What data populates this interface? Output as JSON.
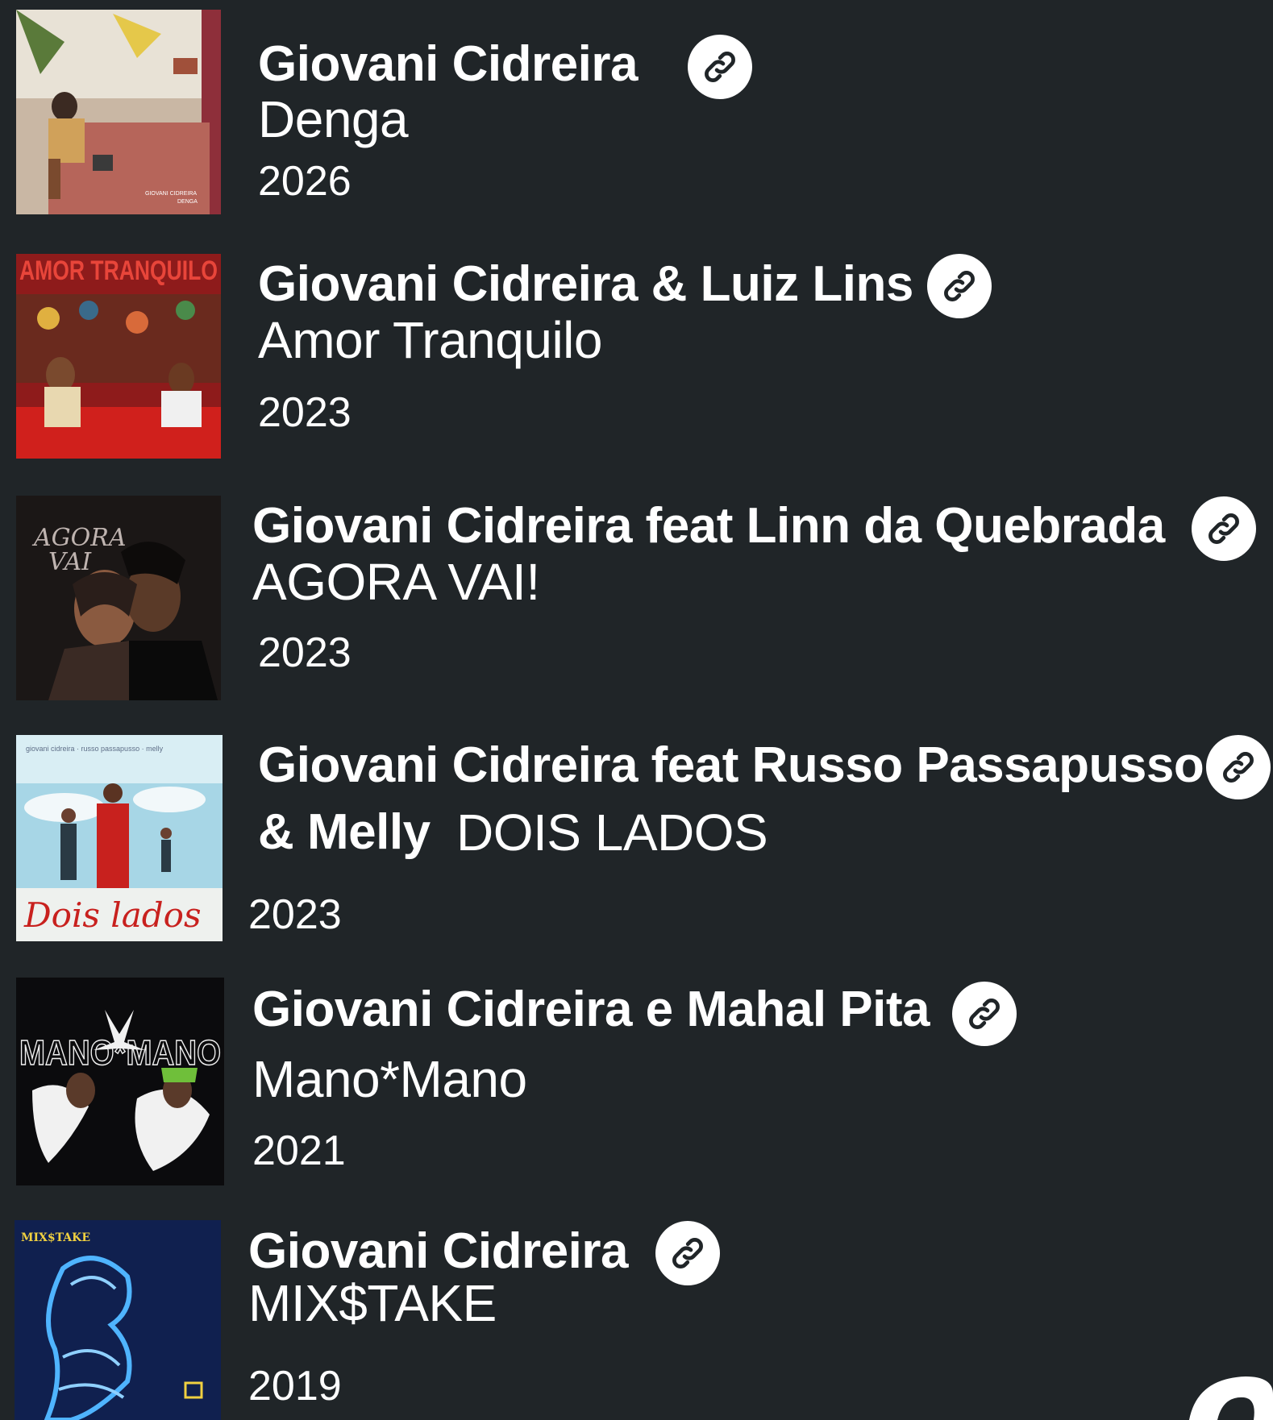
{
  "releases": [
    {
      "artist": "Giovani Cidreira",
      "title": "Denga",
      "year": "2026",
      "cover_text": [
        "GIOVANI CIDREIRA",
        "DENGA"
      ],
      "palette": {
        "bg": "#b89a86",
        "accent": "#8e2f3a",
        "dark": "#3b2a22"
      }
    },
    {
      "artist": "Giovani Cidreira & Luiz Lins",
      "title": "Amor Tranquilo",
      "year": "2023",
      "cover_text": [
        "AMOR TRANQUILO"
      ],
      "palette": {
        "bg": "#8e1b1b",
        "accent": "#e04a2a",
        "dark": "#3a0d0d"
      }
    },
    {
      "artist": "Giovani Cidreira feat Linn da Quebrada",
      "title": "AGORA VAI!",
      "year": "2023",
      "cover_text": [
        "AGORA",
        "VAI"
      ],
      "palette": {
        "bg": "#1b1716",
        "accent": "#6f5a52",
        "dark": "#0d0b0a"
      }
    },
    {
      "artist_line1": "Giovani Cidreira feat Russo Passapusso",
      "artist_line2": "& Melly",
      "title": "DOIS LADOS",
      "year": "2023",
      "cover_text": [
        "giovani cidreira · russo passapusso · melly",
        "Dois lados"
      ],
      "palette": {
        "bg": "#a7d6e6",
        "accent": "#c8211e",
        "dark": "#2a3a44"
      }
    },
    {
      "artist": "Giovani Cidreira e Mahal Pita",
      "title": "Mano*Mano",
      "year": "2021",
      "cover_text": [
        "MANO*MANO"
      ],
      "palette": {
        "bg": "#0b0b0d",
        "accent": "#f1f1f1",
        "dark": "#4d7a2a"
      }
    },
    {
      "artist": "Giovani Cidreira",
      "title": "MIX$TAKE",
      "year": "2019",
      "cover_text": [
        "MIX$TAKE"
      ],
      "palette": {
        "bg": "#10204f",
        "accent": "#4fb4ff",
        "dark": "#070d24"
      }
    }
  ],
  "colors": {
    "background": "#202528",
    "text": "#ffffff",
    "link_button_bg": "#ffffff",
    "link_icon": "#202528"
  },
  "icons": {
    "link": "link-chain-icon"
  }
}
